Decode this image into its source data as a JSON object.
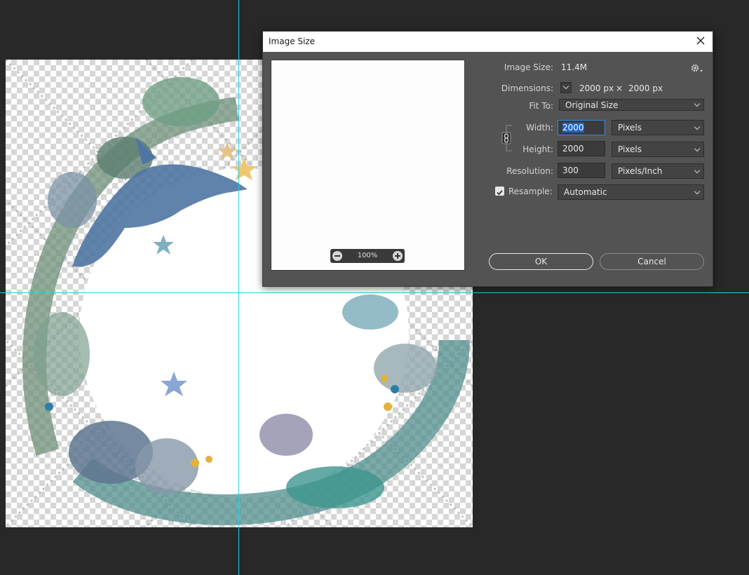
{
  "dialog": {
    "title": "Image Size",
    "image_size_label": "Image Size:",
    "image_size_value": "11.4M",
    "dimensions_label": "Dimensions:",
    "dimensions_width": "2000 px",
    "dimensions_times": "×",
    "dimensions_height": "2000 px",
    "fit_to_label": "Fit To:",
    "fit_to_value": "Original Size",
    "width_label": "Width:",
    "width_value": "2000",
    "width_unit": "Pixels",
    "height_label": "Height:",
    "height_value": "2000",
    "height_unit": "Pixels",
    "resolution_label": "Resolution:",
    "resolution_value": "300",
    "resolution_unit": "Pixels/Inch",
    "resample_label": "Resample:",
    "resample_checked": true,
    "resample_value": "Automatic",
    "preview_zoom": "100%",
    "ok_label": "OK",
    "cancel_label": "Cancel"
  },
  "icons": {
    "gear": "gear-icon",
    "close": "close-icon",
    "link": "link-chain-icon",
    "zoom_out": "zoom-out-icon",
    "zoom_in": "zoom-in-icon"
  },
  "colors": {
    "app_background": "#282828",
    "dialog_background": "#535353",
    "guide": "#21d4e6",
    "selection": "#1f63c7"
  }
}
